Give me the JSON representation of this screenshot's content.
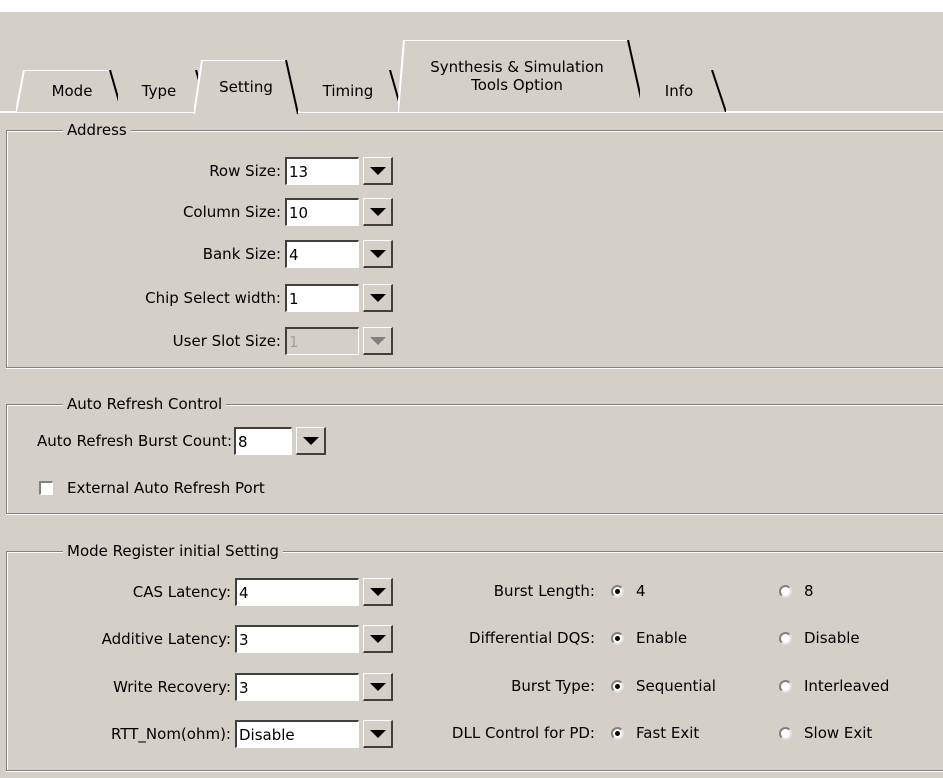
{
  "tabs": [
    {
      "label": "Mode",
      "active": false
    },
    {
      "label": "Type",
      "active": false
    },
    {
      "label": "Setting",
      "active": true
    },
    {
      "label": "Timing",
      "active": false
    },
    {
      "label": "Synthesis & Simulation\nTools Option",
      "active": false
    },
    {
      "label": "Info",
      "active": false
    }
  ],
  "address": {
    "title": "Address",
    "row_size": {
      "label": "Row Size:",
      "value": "13"
    },
    "column_size": {
      "label": "Column Size:",
      "value": "10"
    },
    "bank_size": {
      "label": "Bank Size:",
      "value": "4"
    },
    "chip_select_width": {
      "label": "Chip Select width:",
      "value": "1"
    },
    "user_slot_size": {
      "label": "User Slot Size:",
      "value": "1",
      "disabled": true
    }
  },
  "auto_refresh": {
    "title": "Auto Refresh Control",
    "burst_count": {
      "label": "Auto Refresh Burst Count:",
      "value": "8"
    },
    "external_port": {
      "label": "External Auto Refresh Port",
      "checked": false
    }
  },
  "mode_register": {
    "title": "Mode Register initial Setting",
    "cas_latency": {
      "label": "CAS Latency:",
      "value": "4"
    },
    "additive_latency": {
      "label": "Additive Latency:",
      "value": "3"
    },
    "write_recovery": {
      "label": "Write Recovery:",
      "value": "3"
    },
    "rtt_nom": {
      "label": "RTT_Nom(ohm):",
      "value": "Disable"
    },
    "burst_length": {
      "label": "Burst Length:",
      "opt1": "4",
      "opt2": "8",
      "selected": "4"
    },
    "differential_dqs": {
      "label": "Differential DQS:",
      "opt1": "Enable",
      "opt2": "Disable",
      "selected": "Enable"
    },
    "burst_type": {
      "label": "Burst Type:",
      "opt1": "Sequential",
      "opt2": "Interleaved",
      "selected": "Sequential"
    },
    "dll_control": {
      "label": "DLL Control for PD:",
      "opt1": "Fast Exit",
      "opt2": "Slow Exit",
      "selected": "Fast Exit"
    }
  }
}
